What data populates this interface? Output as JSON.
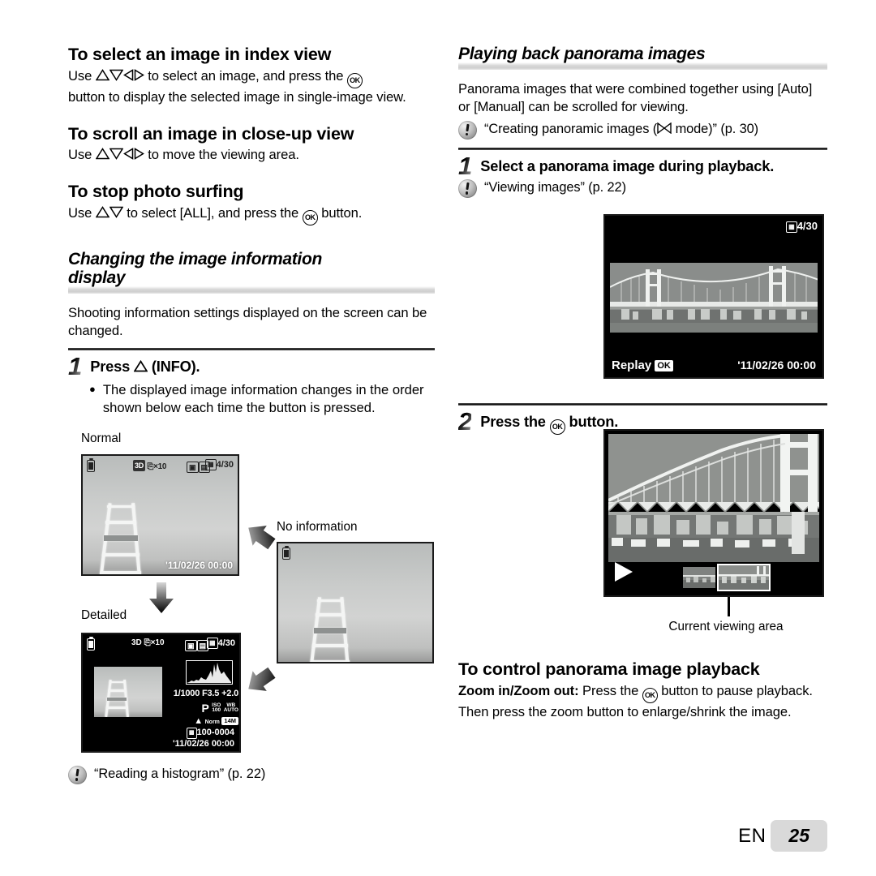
{
  "left": {
    "h_index_view": "To select an image in index view",
    "p_index_view_a": "to select an image, and press the",
    "p_index_view_use": "Use",
    "p_index_view_b": "button to display the selected image in single-image view.",
    "h_scroll": "To scroll an image in close-up view",
    "p_scroll_use": "Use",
    "p_scroll_rest": "to move the viewing area.",
    "h_stop_surfing": "To stop photo surfing",
    "p_stop_use": "Use",
    "p_stop_mid": "to select [ALL], and press the",
    "p_stop_end": "button.",
    "section_title_line1": "Changing the image information",
    "section_title_line2": "display",
    "section_body": "Shooting information settings displayed on the screen can be changed.",
    "step1_num": "1",
    "step1_title_pre": "Press",
    "step1_title_post": "(INFO).",
    "step1_bullet": "The displayed image information changes in the order shown below each time the button is pressed.",
    "label_normal": "Normal",
    "label_detailed": "Detailed",
    "label_no_information": "No information",
    "note_histogram": "“Reading a histogram” (p. 22)"
  },
  "right": {
    "section_title": "Playing back panorama images",
    "section_body": "Panorama images that were combined together using [Auto] or [Manual] can be scrolled for viewing.",
    "note_creating_pre": "“Creating panoramic images (",
    "note_creating_post": " mode)” (p. 30)",
    "step1_num": "1",
    "step1_title": "Select a panorama image during playback.",
    "note_viewing": "“Viewing images” (p. 22)",
    "step2_num": "2",
    "step2_title_pre": "Press the",
    "step2_title_post": "button.",
    "caption_current_area": "Current viewing area",
    "h_control": "To control panorama image playback",
    "control_label": "Zoom in/Zoom out:",
    "control_body": "Press the",
    "control_body2": "button to pause playback. Then press the zoom button to enlarge/shrink the image."
  },
  "screens": {
    "normal": {
      "counter": "4/30",
      "zoom": "×10",
      "flash": "3D",
      "datetime_date": "'11/02/26",
      "datetime_time": "00:00",
      "card_icon": "card-icon",
      "battery_icon": "battery-icon"
    },
    "no_information": {
      "battery_icon": "battery-icon"
    },
    "detailed": {
      "counter": "4/30",
      "zoom": "×10",
      "flash": "3D",
      "shutter": "1/1000",
      "aperture": "F3.5",
      "exposure": "+2.0",
      "mode": "P",
      "iso_label": "ISO",
      "iso_value": "100",
      "wb_label": "WB",
      "wb_value": "AUTO",
      "compression": "Norm",
      "resolution": "14M",
      "file_number": "100-0004",
      "datetime_date": "'11/02/26",
      "datetime_time": "00:00"
    },
    "panorama_full": {
      "counter": "4/30",
      "replay_label": "Replay",
      "replay_key": "OK",
      "datetime_date": "'11/02/26",
      "datetime_time": "00:00"
    },
    "panorama_zoom": {
      "play_icon": "play-triangle-icon"
    }
  },
  "footer": {
    "lang": "EN",
    "page": "25"
  },
  "colors": {
    "heading_bar": "#d3d3d3",
    "footer_box": "#d9d9d9",
    "lcd_border": "#1a1a1a"
  }
}
